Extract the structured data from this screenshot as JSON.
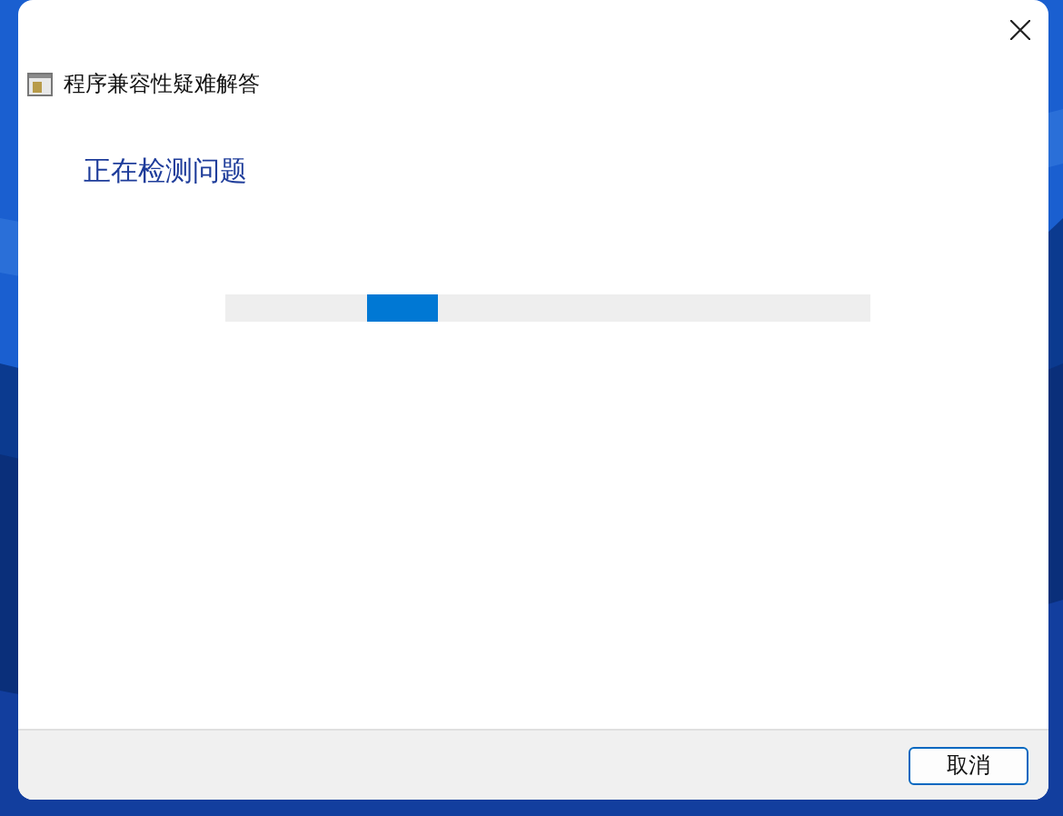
{
  "window": {
    "title": "程序兼容性疑难解答"
  },
  "heading": "正在检测问题",
  "progress": {
    "indeterminate": true
  },
  "buttons": [
    {
      "label": "取消",
      "default": true
    }
  ]
}
